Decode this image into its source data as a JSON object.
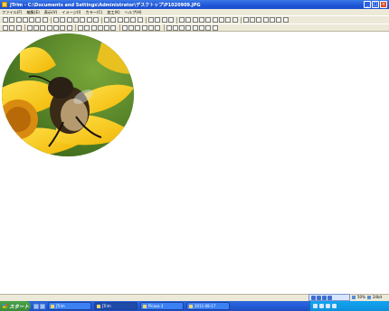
{
  "window": {
    "title": "JTrim - C:\\Documents and Settings\\Administrator\\デスクトップ\\P1020909.JPG",
    "buttons": [
      "minimize",
      "maximize",
      "close"
    ]
  },
  "menu": [
    "ファイル(F)",
    "編集(E)",
    "表示(V)",
    "イメージ(I)",
    "カラー(C)",
    "加工(K)",
    "ヘルプ(H)"
  ],
  "toolbar1_count": 40,
  "toolbar2_count": 30,
  "image": {
    "subject": "bee on yellow flower",
    "mask": "ellipse"
  },
  "status": {
    "zoom": "50%",
    "bits": "24bit"
  },
  "taskbar": {
    "start_label": "スタート",
    "tasks": [
      "JTrim",
      "JTrim",
      "Picasa 3",
      "2011-08-17"
    ],
    "clock": ""
  },
  "colors": {
    "titlebar": "#1f54d6",
    "taskbar": "#245edb",
    "start": "#3a8a3a",
    "tray": "#0d8fdb"
  }
}
